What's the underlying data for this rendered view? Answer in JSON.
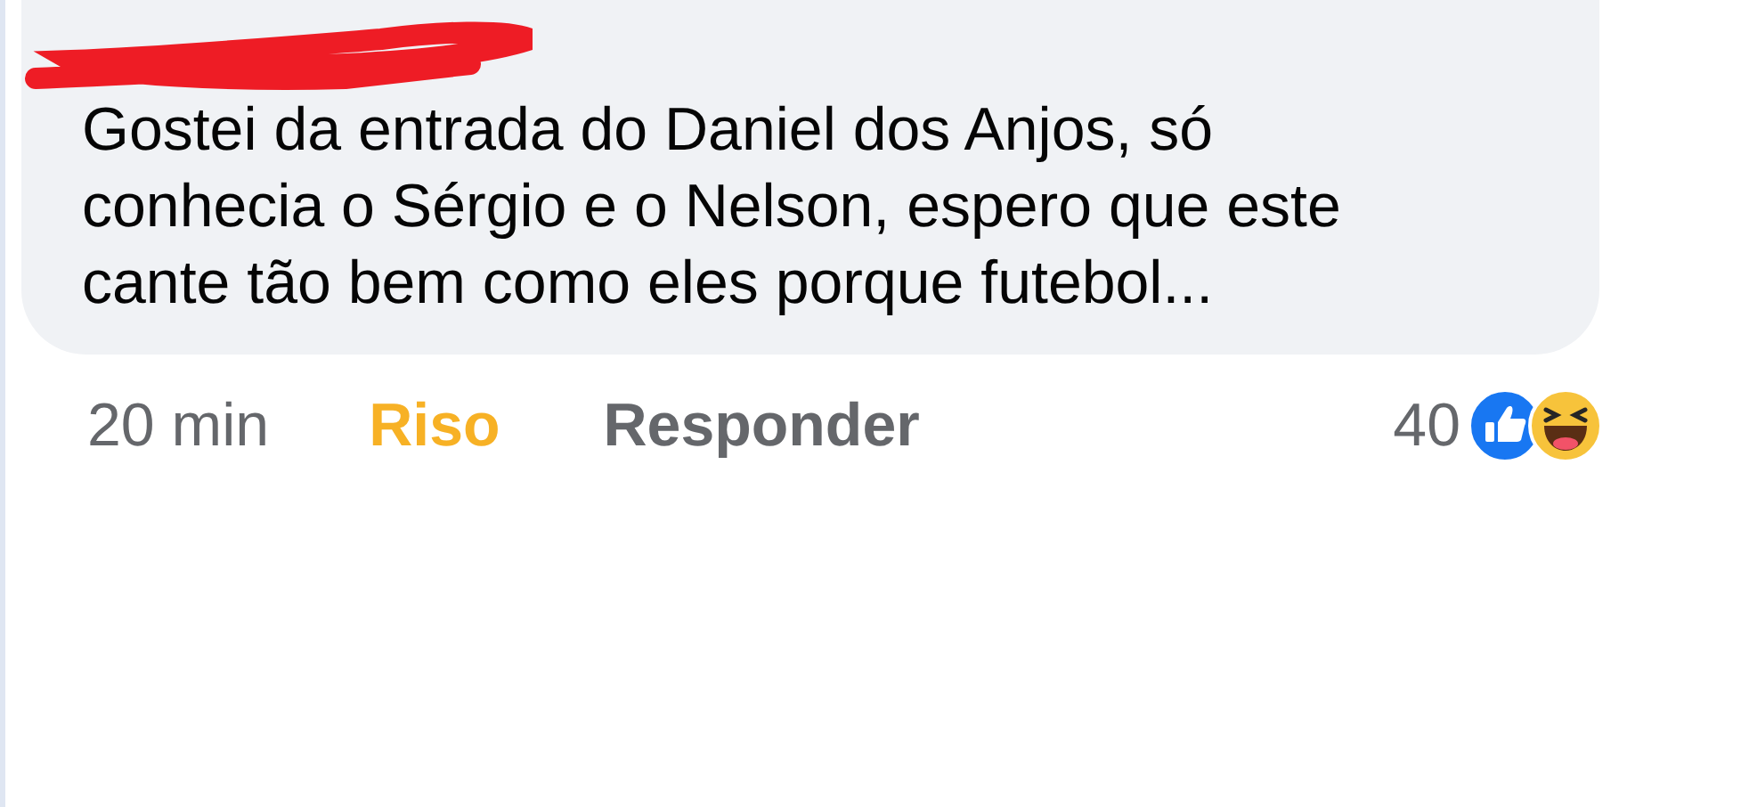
{
  "comment": {
    "text": "Gostei da entrada do Daniel dos Anjos, só conhecia o Sérgio e o Nelson, espero que este cante tão bem como eles porque futebol...",
    "author_redacted": true
  },
  "footer": {
    "time": "20 min",
    "actions": [
      {
        "label": "Riso",
        "kind": "reacted"
      },
      {
        "label": "Responder",
        "kind": "plain"
      }
    ],
    "reaction_count": "40"
  }
}
